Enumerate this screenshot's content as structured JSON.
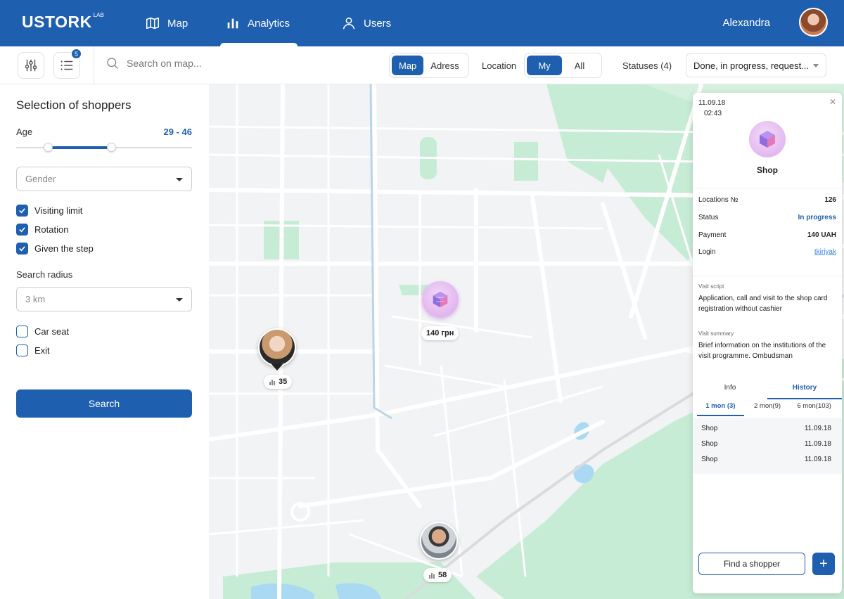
{
  "brand": {
    "logo": "USTORK",
    "logo_sup": "LAB"
  },
  "nav": {
    "map": "Map",
    "analytics": "Analytics",
    "users": "Users"
  },
  "user": {
    "name": "Alexandra"
  },
  "toolbar": {
    "list_badge": "5",
    "search_placeholder": "Search on map...",
    "view_map": "Map",
    "view_adress": "Adress",
    "location_label": "Location",
    "loc_my": "My",
    "loc_all": "All",
    "statuses_label": "Statuses (4)",
    "statuses_value": "Done, in progress, request..."
  },
  "filters": {
    "title": "Selection of shoppers",
    "age_label": "Age",
    "age_value": "29 - 46",
    "age_range": {
      "min_fraction": 0.18,
      "max_fraction": 0.54
    },
    "gender_placeholder": "Gender",
    "checks": [
      {
        "label": "Visiting limit",
        "checked": true
      },
      {
        "label": "Rotation",
        "checked": true
      },
      {
        "label": "Given the step",
        "checked": true
      }
    ],
    "radius_label": "Search radius",
    "radius_value": "3 km",
    "options": [
      {
        "label": "Car seat",
        "checked": false
      },
      {
        "label": "Exit",
        "checked": false
      }
    ],
    "search_button": "Search"
  },
  "map": {
    "shopper1_count": "35",
    "shopper2_count": "58",
    "shop_price": "140 грн"
  },
  "card": {
    "date": "11.09.18",
    "time": "02:43",
    "shop_name": "Shop",
    "rows": {
      "locations_label": "Locations №",
      "locations_value": "126",
      "status_label": "Status",
      "status_value": "In progress",
      "payment_label": "Payment",
      "payment_value": "140 UAH",
      "login_label": "Login",
      "login_value": "tkiriyak"
    },
    "visit_script_label": "Visit script",
    "visit_script": "Application, call  and visit to the shop card registration without cashier",
    "visit_summary_label": "Visit summary",
    "visit_summary": "Brief information on the institutions of the visit programme. Ombudsman",
    "tab_info": "Info",
    "tab_history": "History",
    "sub_1": "1 mon (3)",
    "sub_2": "2 mon(9)",
    "sub_3": "6 mon(103)",
    "history": [
      {
        "name": "Shop",
        "date": "11.09.18"
      },
      {
        "name": "Shop",
        "date": "11.09.18"
      },
      {
        "name": "Shop",
        "date": "11.09.18"
      }
    ],
    "find_button": "Find a shopper",
    "plus": "+"
  },
  "colors": {
    "primary": "#1e5fb0",
    "map_green": "#bfe8cf",
    "map_water": "#9fd3f2"
  }
}
